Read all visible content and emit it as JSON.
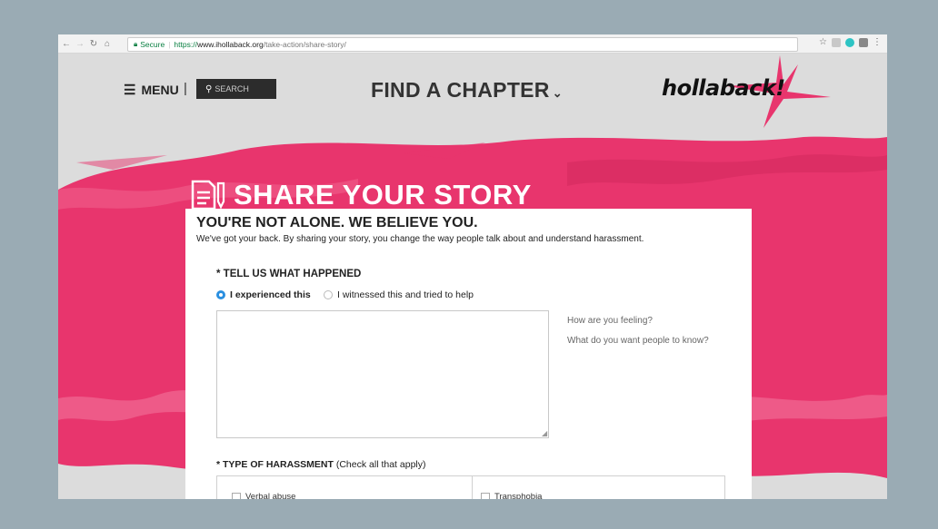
{
  "browser": {
    "secure_label": "Secure",
    "url_scheme": "https://",
    "url_host": "www.ihollaback.org",
    "url_path": "/take-action/share-story/"
  },
  "header": {
    "menu_label": "MENU",
    "menu_separator": "|",
    "search_placeholder": "SEARCH",
    "find_chapter_label": "FIND A CHAPTER",
    "logo_text": "hollaback!"
  },
  "hero": {
    "title": "SHARE YOUR STORY"
  },
  "form": {
    "headline": "YOU'RE NOT ALONE. WE BELIEVE YOU.",
    "subline": "We've got your back. By sharing your story, you change the way people talk about and understand harassment.",
    "tell_label": "* TELL US WHAT HAPPENED",
    "radio_options": [
      {
        "label": "I experienced this",
        "selected": true
      },
      {
        "label": "I witnessed this and tried to help",
        "selected": false
      }
    ],
    "story_value": "",
    "hints": [
      "How are you feeling?",
      "What do you want people to know?"
    ],
    "type_label_bold": "* TYPE OF HARASSMENT",
    "type_label_note": " (Check all that apply)",
    "harassment_types": [
      "Verbal abuse",
      "Transphobia"
    ]
  },
  "colors": {
    "brand_pink": "#e8356d",
    "radio_blue": "#2a8fe0",
    "secure_green": "#0b8043"
  }
}
